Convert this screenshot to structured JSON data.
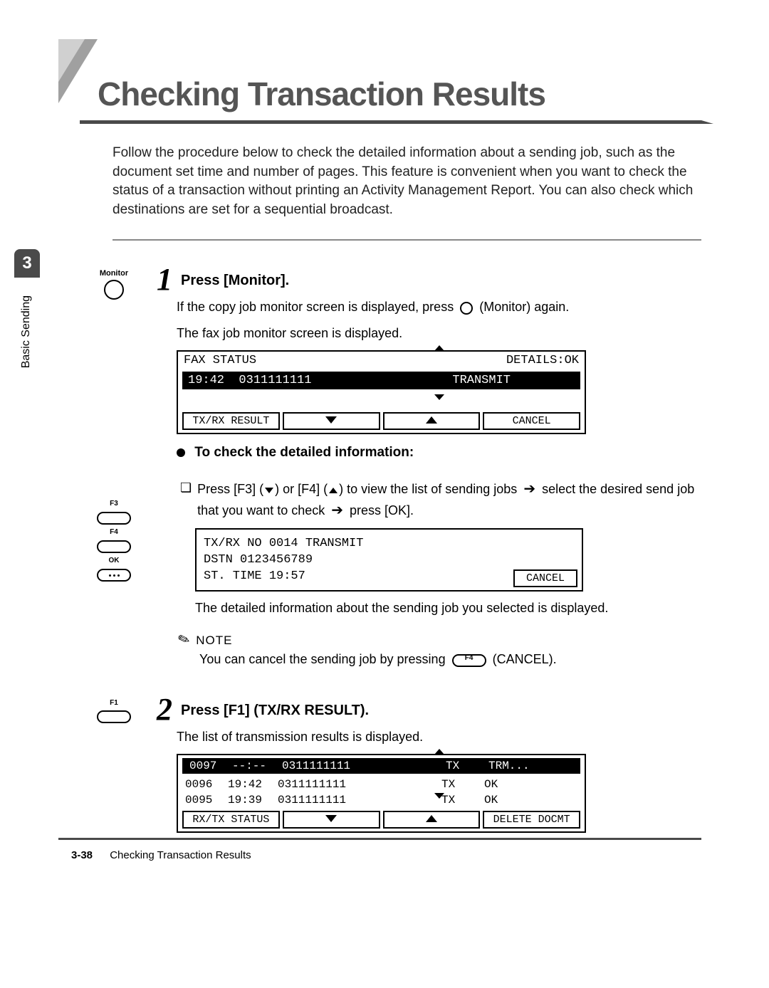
{
  "title": "Checking Transaction Results",
  "intro": "Follow the procedure below to check the detailed information about a sending job, such as the document set time and number of pages. This feature is convenient when you want to check the status of a transaction without printing an Activity Management Report. You can also check which destinations are set for a sequential broadcast.",
  "sideTab": {
    "number": "3",
    "label": "Basic Sending"
  },
  "step1": {
    "iconLabel": "Monitor",
    "num": "1",
    "heading": "Press [Monitor].",
    "body1_pre": "If the copy job monitor screen is displayed, press ",
    "body1_post": " (Monitor) again.",
    "body2": "The fax job monitor screen is displayed.",
    "lcd1": {
      "header_left": "FAX STATUS",
      "header_right": "DETAILS:OK",
      "row_time": "19:42",
      "row_num": "0311111111",
      "row_status": "TRANSMIT",
      "btn1": "TX/RX RESULT",
      "btn4": "CANCEL"
    },
    "bulletHeading": "To check the detailed information:",
    "keys": {
      "f3": "F3",
      "f4": "F4",
      "ok": "OK"
    },
    "subItem_pre": "Press [F3] (",
    "subItem_mid1": ") or [F4] (",
    "subItem_mid2": ") to view the list of sending jobs ",
    "subItem_post": " select the desired send job that you want to check ",
    "subItem_end": " press [OK].",
    "lcd2": {
      "line1": "TX/RX NO 0014    TRANSMIT",
      "line2": "DSTN      0123456789",
      "line3": "ST. TIME  19:57",
      "btn": "CANCEL"
    },
    "detailResult": "The detailed information about the sending job you selected is displayed.",
    "noteLabel": "NOTE",
    "noteBody_pre": "You can cancel the sending job by pressing ",
    "noteKey": "F4",
    "noteBody_post": " (CANCEL)."
  },
  "step2": {
    "key": "F1",
    "num": "2",
    "heading": "Press [F1] (TX/RX RESULT).",
    "body": "The list of transmission results is displayed.",
    "lcd": {
      "rows": [
        {
          "id": "0097",
          "time": "--:--",
          "num": "0311111111",
          "type": "TX",
          "status": "TRM..."
        },
        {
          "id": "0096",
          "time": "19:42",
          "num": "0311111111",
          "type": "TX",
          "status": "OK"
        },
        {
          "id": "0095",
          "time": "19:39",
          "num": "0311111111",
          "type": "TX",
          "status": "OK"
        }
      ],
      "btn1": "RX/TX STATUS",
      "btn4": "DELETE DOCMT"
    }
  },
  "footer": {
    "page": "3-38",
    "label": "Checking Transaction Results"
  }
}
